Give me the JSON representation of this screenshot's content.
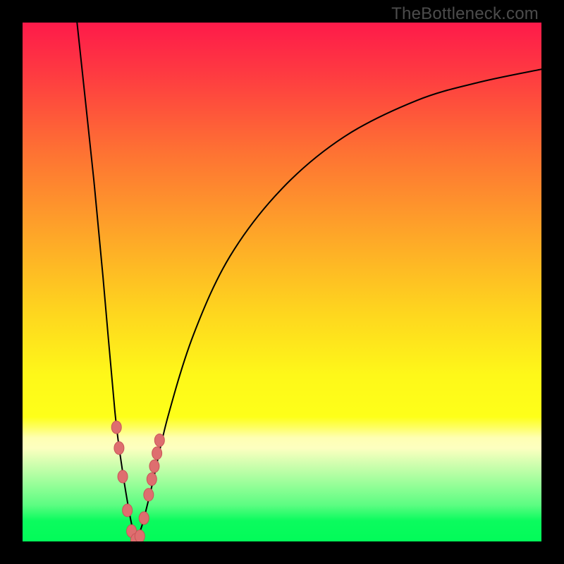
{
  "watermark": "TheBottleneck.com",
  "chart_data": {
    "type": "line",
    "title": "",
    "xlabel": "",
    "ylabel": "",
    "xlim": [
      0,
      100
    ],
    "ylim": [
      0,
      100
    ],
    "grid": false,
    "legend": false,
    "background_gradient": {
      "stops": [
        {
          "pct": 0,
          "color": "#fe1a4a"
        },
        {
          "pct": 10,
          "color": "#fe3b41"
        },
        {
          "pct": 25,
          "color": "#fe7233"
        },
        {
          "pct": 40,
          "color": "#fea329"
        },
        {
          "pct": 55,
          "color": "#fed31f"
        },
        {
          "pct": 68,
          "color": "#fef819"
        },
        {
          "pct": 76,
          "color": "#feff19"
        },
        {
          "pct": 78,
          "color": "#feff61"
        },
        {
          "pct": 80,
          "color": "#feffb2"
        },
        {
          "pct": 82,
          "color": "#fdffc0"
        },
        {
          "pct": 93,
          "color": "#5cfd82"
        },
        {
          "pct": 96,
          "color": "#0bfb5e"
        },
        {
          "pct": 100,
          "color": "#02fb59"
        }
      ]
    },
    "series": [
      {
        "name": "left-branch",
        "type": "curve",
        "x": [
          10.5,
          12.0,
          13.7,
          15.5,
          17.8,
          19.2,
          20.5,
          21.3,
          21.8
        ],
        "y": [
          100,
          86,
          70,
          51,
          25,
          14,
          6,
          2,
          0
        ]
      },
      {
        "name": "right-branch",
        "type": "curve",
        "x": [
          21.8,
          23.0,
          25.0,
          28.0,
          33.0,
          40.0,
          50.0,
          62.0,
          76.0,
          88.0,
          100.0
        ],
        "y": [
          0,
          3,
          11,
          24,
          40,
          55,
          68,
          78,
          85,
          88.5,
          91
        ]
      },
      {
        "name": "markers",
        "type": "scatter",
        "marker_color": "#de6e6f",
        "x": [
          18.1,
          18.6,
          19.3,
          20.2,
          21.0,
          21.8,
          22.6,
          23.4,
          24.3,
          24.9,
          25.4,
          25.9,
          26.4
        ],
        "y": [
          22.0,
          18.0,
          12.5,
          6.0,
          2.0,
          0.3,
          1.0,
          4.5,
          9.0,
          12.0,
          14.5,
          17.0,
          19.5
        ]
      }
    ]
  }
}
